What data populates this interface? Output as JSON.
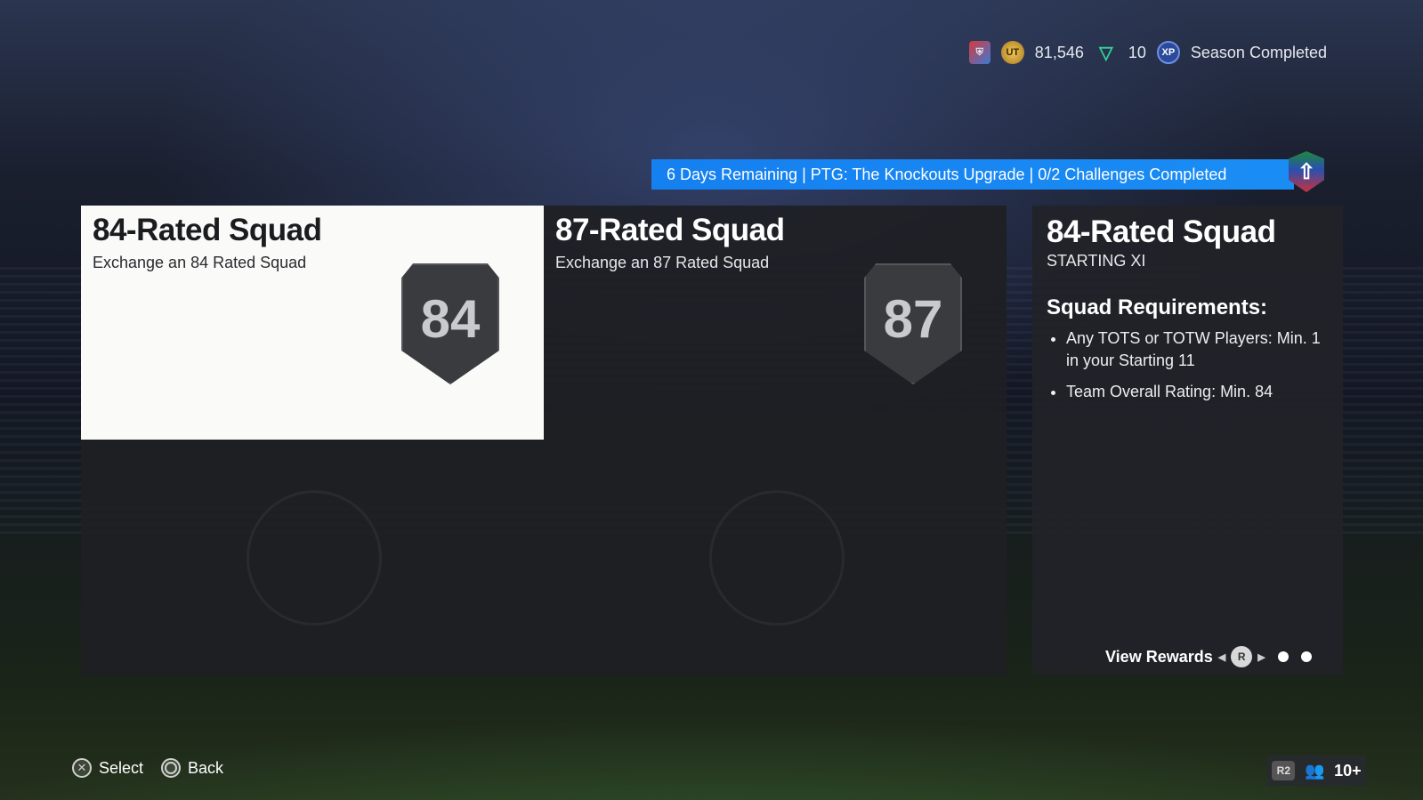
{
  "topbar": {
    "club_icon": "club-badge-icon",
    "coins": "81,546",
    "points": "10",
    "season_status": "Season Completed"
  },
  "banner": {
    "text": "6 Days Remaining | PTG: The Knockouts Upgrade | 0/2 Challenges Completed",
    "badge_icon": "upgrade-arrow-icon"
  },
  "cards": [
    {
      "title": "84-Rated Squad",
      "subtitle": "Exchange an 84 Rated Squad",
      "rating": "84",
      "selected": true
    },
    {
      "title": "87-Rated Squad",
      "subtitle": "Exchange an 87 Rated Squad",
      "rating": "87",
      "selected": false
    }
  ],
  "details": {
    "title": "84-Rated Squad",
    "subtitle": "STARTING XI",
    "requirements_title": "Squad Requirements:",
    "requirements": [
      "Any TOTS or TOTW Players: Min. 1 in your Starting 11",
      "Team Overall Rating: Min. 84"
    ],
    "view_rewards": "View Rewards",
    "r_button": "R"
  },
  "footer": {
    "select_label": "Select",
    "back_label": "Back"
  },
  "friends": {
    "r2_label": "R2",
    "count": "10+"
  },
  "colors": {
    "banner_blue": "#1580f0",
    "selected_card": "#fafaf8"
  }
}
